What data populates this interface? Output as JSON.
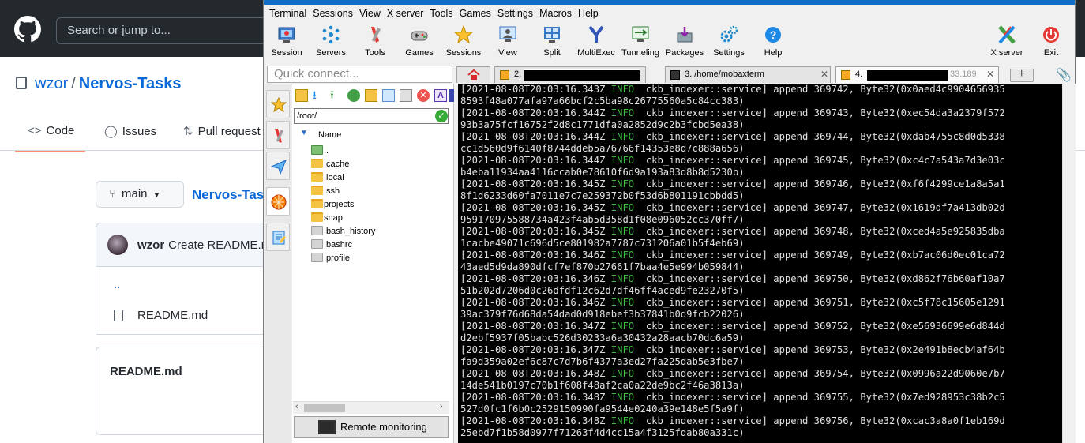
{
  "github": {
    "search_placeholder": "Search or jump to...",
    "owner": "wzor",
    "separator": "/",
    "repo": "Nervos-Tasks",
    "tabs": {
      "code": "Code",
      "issues": "Issues",
      "pull_requests": "Pull request"
    },
    "branch": "main",
    "path": "Nervos-Task",
    "commit_author": "wzor",
    "commit_message": "Create README.m",
    "parent_dir": "..",
    "file": "README.md",
    "readme_title": "README.md"
  },
  "moba": {
    "menu": [
      "Terminal",
      "Sessions",
      "View",
      "X server",
      "Tools",
      "Games",
      "Settings",
      "Macros",
      "Help"
    ],
    "toolbar": {
      "session": "Session",
      "servers": "Servers",
      "tools": "Tools",
      "games": "Games",
      "sessions": "Sessions",
      "view": "View",
      "split": "Split",
      "multiexec": "MultiExec",
      "tunneling": "Tunneling",
      "packages": "Packages",
      "settings": "Settings",
      "help": "Help",
      "xserver": "X server",
      "exit": "Exit"
    },
    "quick_connect": "Quick connect...",
    "tabs": {
      "tab2": "2.",
      "tab3": "3. /home/mobaxterm",
      "tab4": "4.",
      "tab4_suffix": "33.189"
    },
    "sftp": {
      "path": "/root/",
      "header_name": "Name",
      "files": [
        "..",
        ".cache",
        ".local",
        ".ssh",
        "projects",
        "snap",
        ".bash_history",
        ".bashrc",
        ".profile"
      ],
      "remote_monitoring": "Remote monitoring"
    },
    "log": [
      {
        "ts": "[2021-08-08T20:03:16.343Z",
        "lvl": "INFO",
        "msg": "ckb_indexer::service] append 369742, Byte32(0x0aed4c9904656935",
        "cont": "8593f48a077afa97a66bcf2c5ba98c26775560a5c84cc383)"
      },
      {
        "ts": "[2021-08-08T20:03:16.344Z",
        "lvl": "INFO",
        "msg": "ckb_indexer::service] append 369743, Byte32(0xec54da3a2379f572",
        "cont": "93b3a75fcf16752f2d8c1771dfa0a2852d9c2b3fcbd5ea38)"
      },
      {
        "ts": "[2021-08-08T20:03:16.344Z",
        "lvl": "INFO",
        "msg": "ckb_indexer::service] append 369744, Byte32(0xdab4755c8d0d5338",
        "cont": "cc1d560d9f6140f8744ddeb5a76766f14353e8d7c888a656)"
      },
      {
        "ts": "[2021-08-08T20:03:16.344Z",
        "lvl": "INFO",
        "msg": "ckb_indexer::service] append 369745, Byte32(0xc4c7a543a7d3e03c",
        "cont": "b4eba11934aa4116ccab0e78610f6d9a193a83d8b8d5230b)"
      },
      {
        "ts": "[2021-08-08T20:03:16.345Z",
        "lvl": "INFO",
        "msg": "ckb_indexer::service] append 369746, Byte32(0xf6f4299ce1a8a5a1",
        "cont": "8f1d6233d60fa7011e7c7e259372b0f53d6b801191cbbdd5)"
      },
      {
        "ts": "[2021-08-08T20:03:16.345Z",
        "lvl": "INFO",
        "msg": "ckb_indexer::service] append 369747, Byte32(0x1619df7a413db02d",
        "cont": "959170975588734a423f4ab5d358d1f08e096052cc370ff7)"
      },
      {
        "ts": "[2021-08-08T20:03:16.345Z",
        "lvl": "INFO",
        "msg": "ckb_indexer::service] append 369748, Byte32(0xced4a5e925835dba",
        "cont": "1cacbe49071c696d5ce801982a7787c731206a01b5f4eb69)"
      },
      {
        "ts": "[2021-08-08T20:03:16.346Z",
        "lvl": "INFO",
        "msg": "ckb_indexer::service] append 369749, Byte32(0xb7ac06d0ec01ca72",
        "cont": "43aed5d9da890dfcf7ef870b27661f7baa4e5e994b059844)"
      },
      {
        "ts": "[2021-08-08T20:03:16.346Z",
        "lvl": "INFO",
        "msg": "ckb_indexer::service] append 369750, Byte32(0xd862f76b60af10a7",
        "cont": "51b202d7206d0c26dfdf12c62d7df46ff4aced9fe23270f5)"
      },
      {
        "ts": "[2021-08-08T20:03:16.346Z",
        "lvl": "INFO",
        "msg": "ckb_indexer::service] append 369751, Byte32(0xc5f78c15605e1291",
        "cont": "39ac379f76d68da54dad0d918ebef3b37841b0d9fcb22026)"
      },
      {
        "ts": "[2021-08-08T20:03:16.347Z",
        "lvl": "INFO",
        "msg": "ckb_indexer::service] append 369752, Byte32(0xe56936699e6d844d",
        "cont": "d2ebf5937f05babc526d30233a6a30432a28aacb70dc6a59)"
      },
      {
        "ts": "[2021-08-08T20:03:16.347Z",
        "lvl": "INFO",
        "msg": "ckb_indexer::service] append 369753, Byte32(0x2e491b8ecb4af64b",
        "cont": "fa9d359a02ef6c87c7d7b6f4377a3ed27fa225dab5e3fbe7)"
      },
      {
        "ts": "[2021-08-08T20:03:16.348Z",
        "lvl": "INFO",
        "msg": "ckb_indexer::service] append 369754, Byte32(0x0996a22d9060e7b7",
        "cont": "14de541b0197c70b1f608f48af2ca0a22de9bc2f46a3813a)"
      },
      {
        "ts": "[2021-08-08T20:03:16.348Z",
        "lvl": "INFO",
        "msg": "ckb_indexer::service] append 369755, Byte32(0x7ed928953c38b2c5",
        "cont": "527d0fc1f6b0c2529150990fa9544e0240a39e148e5f5a9f)"
      },
      {
        "ts": "[2021-08-08T20:03:16.348Z",
        "lvl": "INFO",
        "msg": "ckb_indexer::service] append 369756, Byte32(0xcac3a8a0f1eb169d",
        "cont": "25ebd7f1b58d0977f71263f4d4cc15a4f3125fdab80a331c)"
      }
    ],
    "colors": {
      "info": "#3dbd3d",
      "terminal_bg": "#000000",
      "terminal_fg": "#e0e0e0",
      "title_bar": "#0f6fc6"
    }
  }
}
